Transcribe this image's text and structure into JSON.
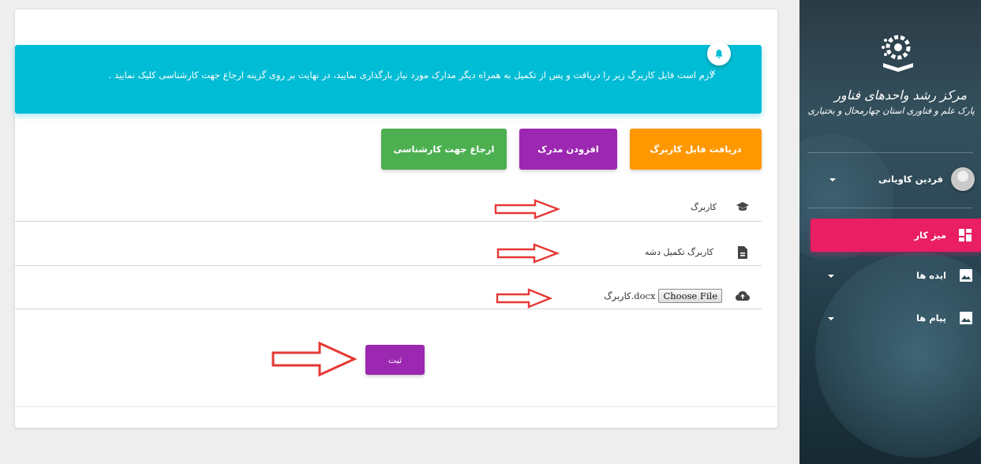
{
  "alert": {
    "text": "لازم است فایل کاربرگ زیر را دریافت و پس از تکمیل به همراه دیگر مدارک مورد نیاز بارگذاری نمایید، در نهایت بر روی گزینه ارجاع جهت کارشناسی کلیک نمایید .",
    "close": "×"
  },
  "actions": {
    "download": "دریافت فایل کاربرگ",
    "add_document": "افزودن مدرک",
    "refer": "ارجاع جهت کارشناسی"
  },
  "rows": {
    "form_label": "کاربرگ",
    "completed_label": "کاربرگ تکمیل دشه",
    "choose_file": "Choose File",
    "file_name": "کاربرگ.docx"
  },
  "submit_label": "ثبت",
  "sidebar": {
    "logo_title": "مرکز رشد واحدهای فناور",
    "logo_subtitle": "پارک علم و فناوری استان چهارمحال و بختیاری",
    "user_name": "فردین کاویانی",
    "items": [
      {
        "label": "میز کار"
      },
      {
        "label": "ایده ها"
      },
      {
        "label": "پیام ها"
      }
    ]
  },
  "colors": {
    "alert": "#00bcd4",
    "orange": "#ff9800",
    "purple": "#9c27b0",
    "green": "#4caf50",
    "active_nav": "#e91e63",
    "arrow": "#e53935"
  }
}
